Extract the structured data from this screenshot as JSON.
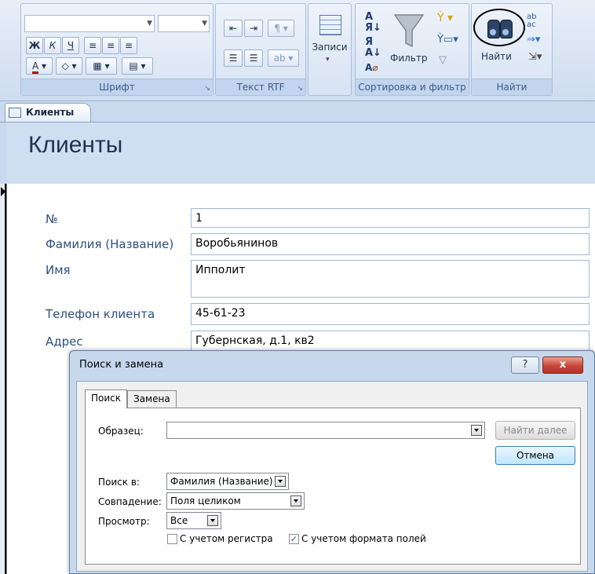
{
  "ribbon": {
    "font_group": {
      "label": "Шрифт",
      "bold": "Ж",
      "italic": "К",
      "underline": "Ч",
      "font_color": "A"
    },
    "rtf_group": {
      "label": "Текст RTF"
    },
    "records_group": {
      "label": "Записи"
    },
    "sort_group": {
      "label": "Сортировка и фильтр",
      "filter_label": "Фильтр"
    },
    "find_group": {
      "label": "Найти",
      "find_label": "Найти"
    }
  },
  "document_tab": {
    "label": "Клиенты"
  },
  "form": {
    "title": "Клиенты",
    "fields": [
      {
        "label": "№",
        "value": "1"
      },
      {
        "label": "Фамилия (Название)",
        "value": "Воробьянинов"
      },
      {
        "label": "Имя",
        "value": "Ипполит"
      },
      {
        "label": "Телефон клиента",
        "value": "45-61-23"
      },
      {
        "label": "Адрес",
        "value": "Губернская, д.1, кв2"
      }
    ]
  },
  "dialog": {
    "title": "Поиск и замена",
    "help": "?",
    "close": "x",
    "tabs": [
      "Поиск",
      "Замена"
    ],
    "pattern_label": "Образец:",
    "pattern_value": "",
    "find_next": "Найти далее",
    "cancel": "Отмена",
    "look_in_label": "Поиск в:",
    "look_in_value": "Фамилия (Название)",
    "match_label": "Совпадение:",
    "match_value": "Поля целиком",
    "search_label": "Просмотр:",
    "search_value": "Все",
    "match_case_label": "С учетом регистра",
    "match_case_checked": false,
    "format_label": "С учетом формата полей",
    "format_checked": true
  },
  "colors": {
    "ribbon_bg": "#cfdcef",
    "form_header_bg": "#cfdff2",
    "label_color": "#2f4f7c",
    "close_button": "#c9463a"
  }
}
